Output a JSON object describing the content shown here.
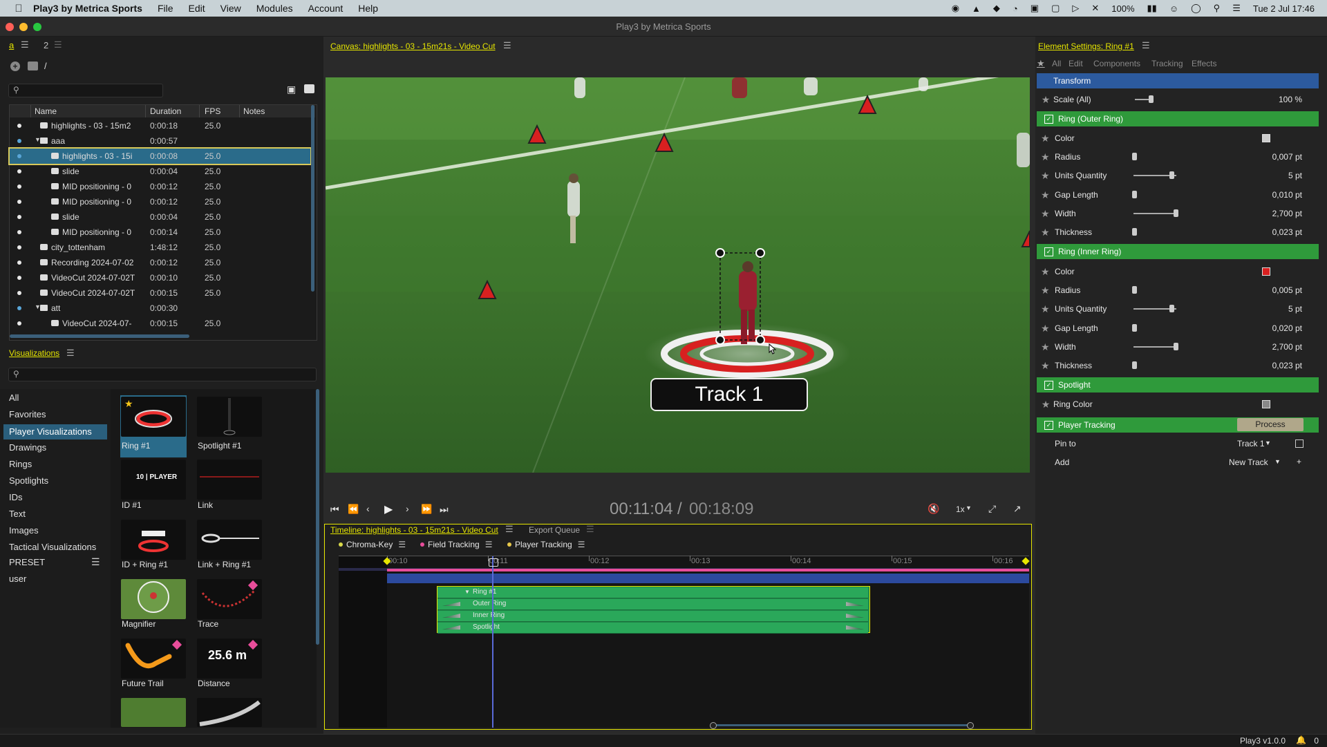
{
  "menubar": {
    "app_name": "Play3 by Metrica Sports",
    "items": [
      "File",
      "Edit",
      "View",
      "Modules",
      "Account",
      "Help"
    ],
    "battery": "100%",
    "clock": "Tue 2 Jul  17:46"
  },
  "window": {
    "title": "Play3 by Metrica Sports"
  },
  "library": {
    "tab_a": "a",
    "tab_2": "2",
    "path": "/",
    "columns": [
      "Name",
      "Duration",
      "FPS",
      "Notes"
    ],
    "rows": [
      {
        "name": "highlights - 03 - 15m2",
        "duration": "0:00:18",
        "fps": "25.0"
      },
      {
        "name": "aaa",
        "duration": "0:00:57",
        "fps": ""
      },
      {
        "name": "highlights - 03 - 15i",
        "duration": "0:00:08",
        "fps": "25.0"
      },
      {
        "name": "slide",
        "duration": "0:00:04",
        "fps": "25.0"
      },
      {
        "name": "MID positioning - 0",
        "duration": "0:00:12",
        "fps": "25.0"
      },
      {
        "name": "MID positioning - 0",
        "duration": "0:00:12",
        "fps": "25.0"
      },
      {
        "name": "slide",
        "duration": "0:00:04",
        "fps": "25.0"
      },
      {
        "name": "MID positioning - 0",
        "duration": "0:00:14",
        "fps": "25.0"
      },
      {
        "name": "city_tottenham",
        "duration": "1:48:12",
        "fps": "25.0"
      },
      {
        "name": "Recording 2024-07-02",
        "duration": "0:00:12",
        "fps": "25.0"
      },
      {
        "name": "VideoCut 2024-07-02T",
        "duration": "0:00:10",
        "fps": "25.0"
      },
      {
        "name": "VideoCut 2024-07-02T",
        "duration": "0:00:15",
        "fps": "25.0"
      },
      {
        "name": "att",
        "duration": "0:00:30",
        "fps": ""
      },
      {
        "name": "VideoCut 2024-07-",
        "duration": "0:00:15",
        "fps": "25.0"
      }
    ]
  },
  "visualizations": {
    "title": "Visualizations",
    "categories": [
      "All",
      "Favorites",
      "Player Visualizations",
      "Drawings",
      "Rings",
      "Spotlights",
      "IDs",
      "Text",
      "Images",
      "Tactical Visualizations",
      "PRESET",
      "user"
    ],
    "tiles": [
      "Ring #1",
      "Spotlight #1",
      "ID #1",
      "Link",
      "ID + Ring #1",
      "Link + Ring #1",
      "Magnifier",
      "Trace",
      "Future Trail",
      "Distance"
    ],
    "id_tile_text": "10 | PLAYER",
    "distance_tile_text": "25.6 m"
  },
  "canvas": {
    "title": "Canvas: highlights - 03 - 15m21s - Video Cut",
    "track_label": "Track 1",
    "time_current": "00:11:04",
    "time_sep": "/",
    "time_total": "00:18:09",
    "speed": "1x"
  },
  "timeline": {
    "title": "Timeline: highlights - 03 - 15m21s - Video Cut",
    "export_queue": "Export Queue",
    "groups": [
      {
        "label": "Chroma-Key",
        "color": "#d8d84a"
      },
      {
        "label": "Field Tracking",
        "color": "#e84d9a"
      },
      {
        "label": "Player Tracking",
        "color": "#e8c84a"
      }
    ],
    "ticks": [
      "00:10",
      "00:11",
      "00:12",
      "00:13",
      "00:14",
      "00:15",
      "00:16"
    ],
    "clips": [
      "Ring #1",
      "Outer Ring",
      "Inner Ring",
      "Spotlight"
    ]
  },
  "settings": {
    "title": "Element Settings: Ring #1",
    "tabs": [
      "All",
      "Edit",
      "Components",
      "Tracking",
      "Effects"
    ],
    "transform": "Transform",
    "scale_label": "Scale (All)",
    "scale_value": "100 %",
    "outer_ring": "Ring (Outer Ring)",
    "outer": [
      {
        "label": "Color",
        "value": ""
      },
      {
        "label": "Radius",
        "value": "0,007 pt"
      },
      {
        "label": "Units Quantity",
        "value": "5 pt"
      },
      {
        "label": "Gap Length",
        "value": "0,010 pt"
      },
      {
        "label": "Width",
        "value": "2,700 pt"
      },
      {
        "label": "Thickness",
        "value": "0,023 pt"
      }
    ],
    "inner_ring": "Ring (Inner Ring)",
    "inner": [
      {
        "label": "Color",
        "value": ""
      },
      {
        "label": "Radius",
        "value": "0,005 pt"
      },
      {
        "label": "Units Quantity",
        "value": "5 pt"
      },
      {
        "label": "Gap Length",
        "value": "0,020 pt"
      },
      {
        "label": "Width",
        "value": "2,700 pt"
      },
      {
        "label": "Thickness",
        "value": "0,023 pt"
      }
    ],
    "spotlight": "Spotlight",
    "ring_color": "Ring Color",
    "player_tracking": "Player Tracking",
    "process": "Process",
    "pin_to": "Pin to",
    "pin_value": "Track 1",
    "add": "Add",
    "add_value": "New Track",
    "add_plus": "+"
  },
  "status": {
    "version": "Play3 v1.0.0",
    "notifications": "0"
  },
  "colors": {
    "accent_yellow": "#e6e600",
    "section_green": "#2f9a3b",
    "section_blue": "#2c5a9e",
    "selection_blue": "#2a6b8a"
  }
}
